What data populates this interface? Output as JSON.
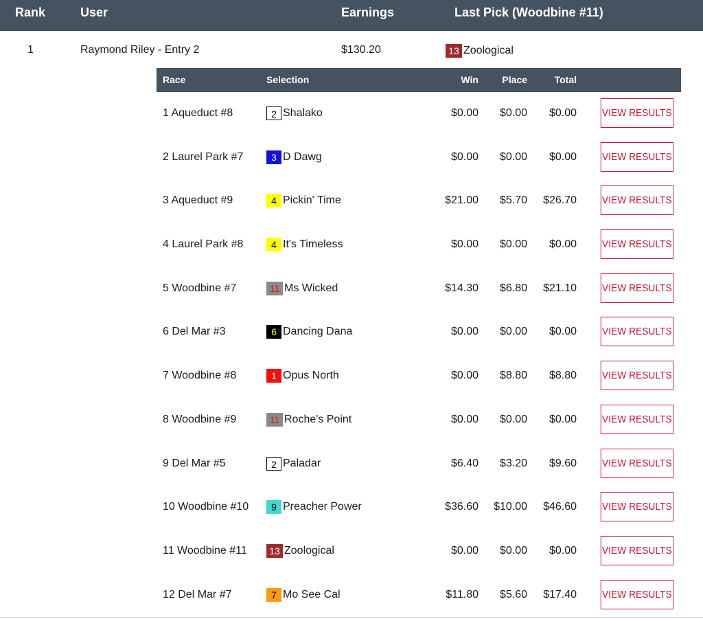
{
  "header": {
    "rank_label": "Rank",
    "user_label": "User",
    "earnings_label": "Earnings",
    "last_pick_label": "Last Pick (Woodbine #11)"
  },
  "entry": {
    "rank": "1",
    "user": "Raymond Riley - Entry 2",
    "earnings": "$130.20",
    "last_pick": {
      "number": "13",
      "name": "Zoological",
      "bg": "#9e2a2b",
      "fg": "#ffffff",
      "border": ""
    }
  },
  "sub_header": {
    "race": "Race",
    "selection": "Selection",
    "win": "Win",
    "place": "Place",
    "total": "Total"
  },
  "view_results_label": "VIEW RESULTS",
  "races": [
    {
      "race": "1 Aqueduct #8",
      "number": "2",
      "horse": "Shalako",
      "bg": "#ffffff",
      "fg": "#000000",
      "border": "#000000",
      "win": "$0.00",
      "place": "$0.00",
      "total": "$0.00"
    },
    {
      "race": "2 Laurel Park #7",
      "number": "3",
      "horse": "D Dawg",
      "bg": "#1010e0",
      "fg": "#ffffff",
      "border": "",
      "win": "$0.00",
      "place": "$0.00",
      "total": "$0.00"
    },
    {
      "race": "3 Aqueduct #9",
      "number": "4",
      "horse": "Pickin' Time",
      "bg": "#ffff00",
      "fg": "#000000",
      "border": "",
      "win": "$21.00",
      "place": "$5.70",
      "total": "$26.70"
    },
    {
      "race": "4 Laurel Park #8",
      "number": "4",
      "horse": "It's Timeless",
      "bg": "#ffff00",
      "fg": "#000000",
      "border": "",
      "win": "$0.00",
      "place": "$0.00",
      "total": "$0.00"
    },
    {
      "race": "5 Woodbine #7",
      "number": "11",
      "horse": "Ms Wicked",
      "bg": "#8a8a8a",
      "fg": "#e01010",
      "border": "",
      "win": "$14.30",
      "place": "$6.80",
      "total": "$21.10"
    },
    {
      "race": "6 Del Mar #3",
      "number": "6",
      "horse": "Dancing Dana",
      "bg": "#000000",
      "fg": "#ffff00",
      "border": "",
      "win": "$0.00",
      "place": "$0.00",
      "total": "$0.00"
    },
    {
      "race": "7 Woodbine #8",
      "number": "1",
      "horse": "Opus North",
      "bg": "#f01010",
      "fg": "#ffffff",
      "border": "",
      "win": "$0.00",
      "place": "$8.80",
      "total": "$8.80"
    },
    {
      "race": "8 Woodbine #9",
      "number": "11",
      "horse": "Roche's Point",
      "bg": "#8a8a8a",
      "fg": "#e01010",
      "border": "",
      "win": "$0.00",
      "place": "$0.00",
      "total": "$0.00"
    },
    {
      "race": "9 Del Mar #5",
      "number": "2",
      "horse": "Paladar",
      "bg": "#ffffff",
      "fg": "#000000",
      "border": "#000000",
      "win": "$6.40",
      "place": "$3.20",
      "total": "$9.60"
    },
    {
      "race": "10 Woodbine #10",
      "number": "9",
      "horse": "Preacher Power",
      "bg": "#40d8d0",
      "fg": "#000000",
      "border": "",
      "win": "$36.60",
      "place": "$10.00",
      "total": "$46.60"
    },
    {
      "race": "11 Woodbine #11",
      "number": "13",
      "horse": "Zoological",
      "bg": "#9e2a2b",
      "fg": "#ffffff",
      "border": "",
      "win": "$0.00",
      "place": "$0.00",
      "total": "$0.00"
    },
    {
      "race": "12 Del Mar #7",
      "number": "7",
      "horse": "Mo See Cal",
      "bg": "#ff9a10",
      "fg": "#000000",
      "border": "",
      "win": "$11.80",
      "place": "$5.60",
      "total": "$17.40"
    }
  ]
}
